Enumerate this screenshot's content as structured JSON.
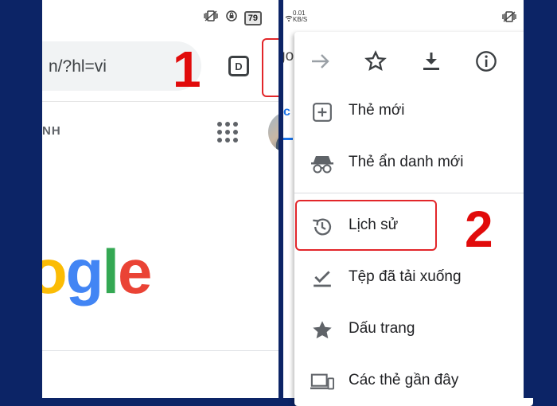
{
  "left": {
    "status": {
      "battery": "79"
    },
    "url_text": "n/?hl=vi",
    "step_number": "1",
    "tab_count": "D",
    "section_text": "NH",
    "logo_text": "ogle",
    "logo_colors": [
      "#fbbc05",
      "#4285f4",
      "#34a853",
      "#ea4335"
    ]
  },
  "right": {
    "speed_value": "0.01",
    "speed_unit": "KB/S",
    "tab_fragment": "go",
    "c_fragment": "c",
    "step_number": "2",
    "menu": {
      "top_icons": [
        "forward-arrow-icon",
        "star-icon",
        "download-icon",
        "info-icon"
      ],
      "items": [
        {
          "label": "Thẻ mới",
          "icon": "new-tab-icon"
        },
        {
          "label": "Thẻ ẩn danh mới",
          "icon": "incognito-icon"
        },
        {
          "label": "Lịch sử",
          "icon": "history-icon"
        },
        {
          "label": "Tệp đã tải xuống",
          "icon": "downloads-check-icon"
        },
        {
          "label": "Dấu trang",
          "icon": "bookmark-star-icon"
        },
        {
          "label": "Các thẻ gần đây",
          "icon": "recent-tabs-icon"
        }
      ]
    }
  },
  "colors": {
    "background": "#0c2466",
    "highlight": "#e2262a",
    "step_number": "#e10b0b"
  }
}
